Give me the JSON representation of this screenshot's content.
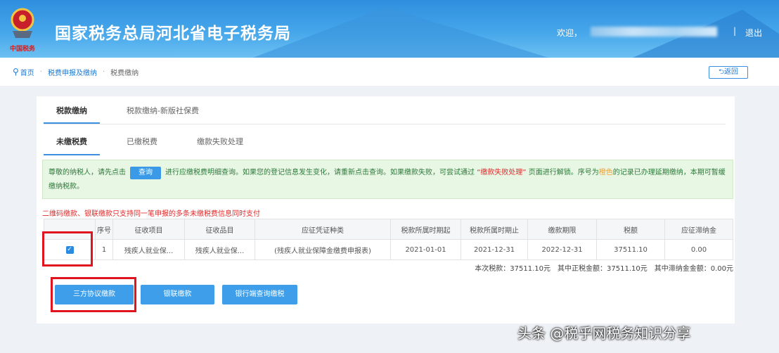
{
  "header": {
    "title": "国家税务总局河北省电子税务局",
    "logo_text": "中国税务",
    "welcome": "欢迎，",
    "separator": "|",
    "logout": "退出"
  },
  "breadcrumb": {
    "items": [
      "首页",
      "税费申报及缴纳",
      "税费缴纳"
    ],
    "back": "返回"
  },
  "tabs": [
    "税款缴纳",
    "税款缴纳-新版社保费"
  ],
  "subtabs": [
    "未缴税费",
    "已缴税费",
    "缴款失败处理"
  ],
  "notice": {
    "part1": "尊敬的纳税人，请先点击",
    "query_button": "查询",
    "part2": "进行应缴税费明细查询。如果您的登记信息发生变化，请重新点击查询。如果缴款失败，可尝试通过",
    "link": "“缴款失败处理”",
    "part3": "页面进行解锁。序号为",
    "orange": "橙色",
    "part4": "的记录已办理延期缴纳，本期可暂缓缴纳税款。"
  },
  "warning": "二维码缴款、银联缴款只支持同一笔申报的多条未缴税费信息同时支付",
  "table": {
    "headers": [
      "序号",
      "征收项目",
      "征收品目",
      "应征凭证种类",
      "税款所属时期起",
      "税款所属时期止",
      "缴款期限",
      "税额",
      "应征滞纳金"
    ],
    "rows": [
      {
        "checked": true,
        "cells": [
          "1",
          "残疾人就业保...",
          "残疾人就业保...",
          "(残疾人就业保障金缴费申报表)",
          "2021-01-01",
          "2021-12-31",
          "2022-12-31",
          "37511.10",
          "0.00"
        ]
      }
    ]
  },
  "summary": "本次税款：37511.10元　其中正税金额：37511.10元　其中滞纳金金额：0.00元",
  "buttons": [
    "三方协议缴款",
    "银联缴款",
    "银行端查询缴税"
  ],
  "watermark": "头条 @税乎网税务知识分享"
}
